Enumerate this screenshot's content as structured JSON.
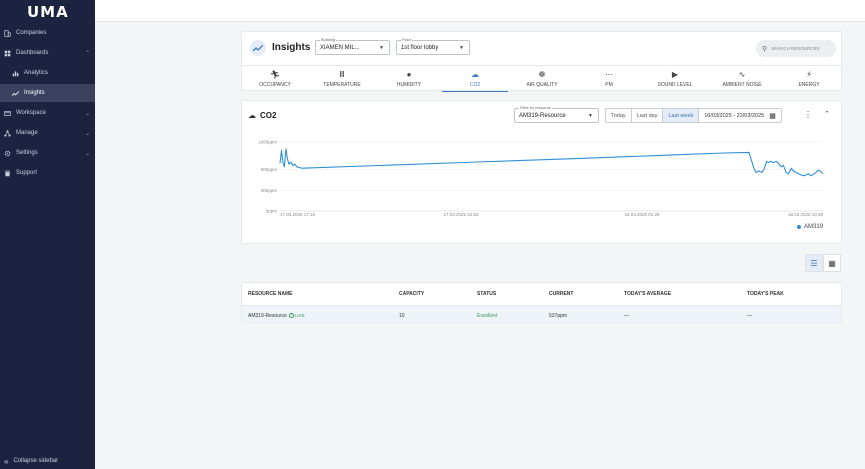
{
  "app": {
    "logo": "UMA"
  },
  "sidebar": {
    "items": [
      {
        "label": "Companies",
        "icon": "building-icon"
      },
      {
        "label": "Dashboards",
        "icon": "dashboard-icon"
      },
      {
        "label": "Analytics",
        "icon": "bar-chart-icon"
      },
      {
        "label": "Insights",
        "icon": "trend-icon"
      },
      {
        "label": "Workspace",
        "icon": "window-icon"
      },
      {
        "label": "Manage",
        "icon": "hierarchy-icon"
      },
      {
        "label": "Settings",
        "icon": "gear-icon"
      },
      {
        "label": "Support",
        "icon": "book-icon"
      }
    ],
    "collapse_label": "Collapse sidebar"
  },
  "header": {
    "title": "Insights",
    "building": {
      "label": "Building",
      "value": "XIAMEN MIL..."
    },
    "floor": {
      "label": "Floor",
      "value": "1st floor lobby"
    },
    "search_placeholder": "SEARCH RESOURCES"
  },
  "tabs": [
    {
      "label": "OCCUPANCY",
      "icon": "person-walk-icon"
    },
    {
      "label": "TEMPERATURE",
      "icon": "thermometer-icon"
    },
    {
      "label": "HUMIDITY",
      "icon": "drop-icon"
    },
    {
      "label": "CO2",
      "icon": "cloud-icon",
      "active": true
    },
    {
      "label": "AIR QUALITY",
      "icon": "fan-icon"
    },
    {
      "label": "PM",
      "icon": "particles-icon"
    },
    {
      "label": "SOUND LEVEL",
      "icon": "speaker-icon"
    },
    {
      "label": "AMBIENT NOISE",
      "icon": "ear-icon"
    },
    {
      "label": "ENERGY",
      "icon": "bolt-icon"
    }
  ],
  "chart_panel": {
    "title": "CO2",
    "filter": {
      "label": "Filter by resource",
      "value": "AM319-Resource"
    },
    "range_buttons": [
      "Today",
      "Last day",
      "Last week"
    ],
    "active_range": "Last week",
    "date_range": "16/03/2025 - 22/03/2025"
  },
  "chart_data": {
    "type": "line",
    "y_ticks": [
      "1000ppm",
      "600ppm",
      "300ppm",
      "0ppm"
    ],
    "y_values": [
      1000,
      600,
      300,
      0
    ],
    "ylim": [
      0,
      1000
    ],
    "x_ticks": [
      "17.03.2025 17:18",
      "17.03.2025 22:52",
      "18.03.2025 04:25",
      "18.03.2025 10:28"
    ],
    "series": [
      {
        "name": "AM319",
        "color": "#2e8fd6",
        "x": [
          0,
          0.3,
          0.6,
          0.9,
          1.2,
          1.5,
          1.8,
          2.2,
          2.6,
          3,
          3.4,
          3.8,
          4.5,
          6,
          20,
          40,
          60,
          75,
          82,
          90,
          95,
          96,
          96.4,
          97,
          97.6,
          98,
          98.6,
          99,
          99.4,
          100,
          100.5,
          101,
          101.5,
          102,
          102.5,
          103,
          103.6,
          104,
          104.5,
          105,
          105.6,
          106,
          106.5,
          107,
          107.5,
          108,
          108.6,
          109,
          109.4,
          110
        ],
        "y": [
          690,
          880,
          700,
          640,
          900,
          760,
          680,
          710,
          660,
          680,
          640,
          630,
          620,
          625,
          660,
          710,
          760,
          800,
          820,
          840,
          850,
          620,
          560,
          580,
          560,
          600,
          720,
          700,
          720,
          700,
          720,
          690,
          640,
          660,
          560,
          540,
          620,
          580,
          560,
          540,
          520,
          510,
          520,
          540,
          510,
          530,
          560,
          590,
          580,
          540
        ]
      }
    ],
    "legend": [
      "AM319"
    ],
    "legend_position": "bottom-right",
    "grid": true
  },
  "table": {
    "columns": [
      "RESOURCE NAME",
      "CAPACITY",
      "STATUS",
      "CURRENT",
      "TODAY'S AVERAGE",
      "TODAY'S PEAK"
    ],
    "rows": [
      {
        "name": "AM319-Resource",
        "live": "LIVE",
        "capacity": "10",
        "status": "Excellent",
        "current": "537ppm",
        "average": "—",
        "peak": "—"
      }
    ]
  }
}
